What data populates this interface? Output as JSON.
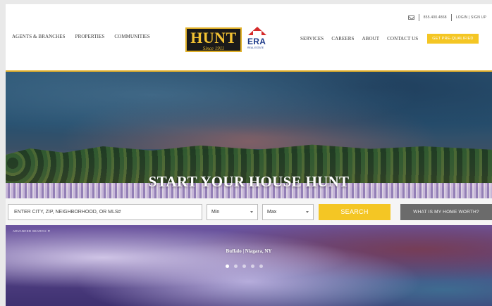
{
  "topbar": {
    "phone": "855.400.4868",
    "login": "LOGIN | SIGN UP"
  },
  "nav_left": [
    "AGENTS & BRANCHES",
    "PROPERTIES",
    "COMMUNITIES"
  ],
  "logo": {
    "hunt_word": "HUNT",
    "since": "Since 1911",
    "era_word": "ERA",
    "era_sub": "REAL ESTATE"
  },
  "nav_right": [
    "SERVICES",
    "CAREERS",
    "ABOUT",
    "CONTACT US"
  ],
  "cta_label": "GET PRE-QUALIFIED",
  "hero": {
    "title": "START YOUR HOUSE HUNT",
    "location": "Buffalo | Niagara, NY",
    "advanced_search": "ADVANCED SEARCH ▼",
    "slide_count": 5,
    "active_slide": 1
  },
  "search": {
    "placeholder": "ENTER CITY, ZIP, NEIGHBORHOOD, OR MLS#",
    "min_label": "Min",
    "max_label": "Max",
    "button_label": "SEARCH",
    "worth_label": "WHAT IS MY HOME WORTH?"
  },
  "colors": {
    "accent": "#f4c624",
    "gold_rule": "#e5b12a",
    "era_red": "#d52b2b",
    "era_blue": "#1d3a8a"
  }
}
